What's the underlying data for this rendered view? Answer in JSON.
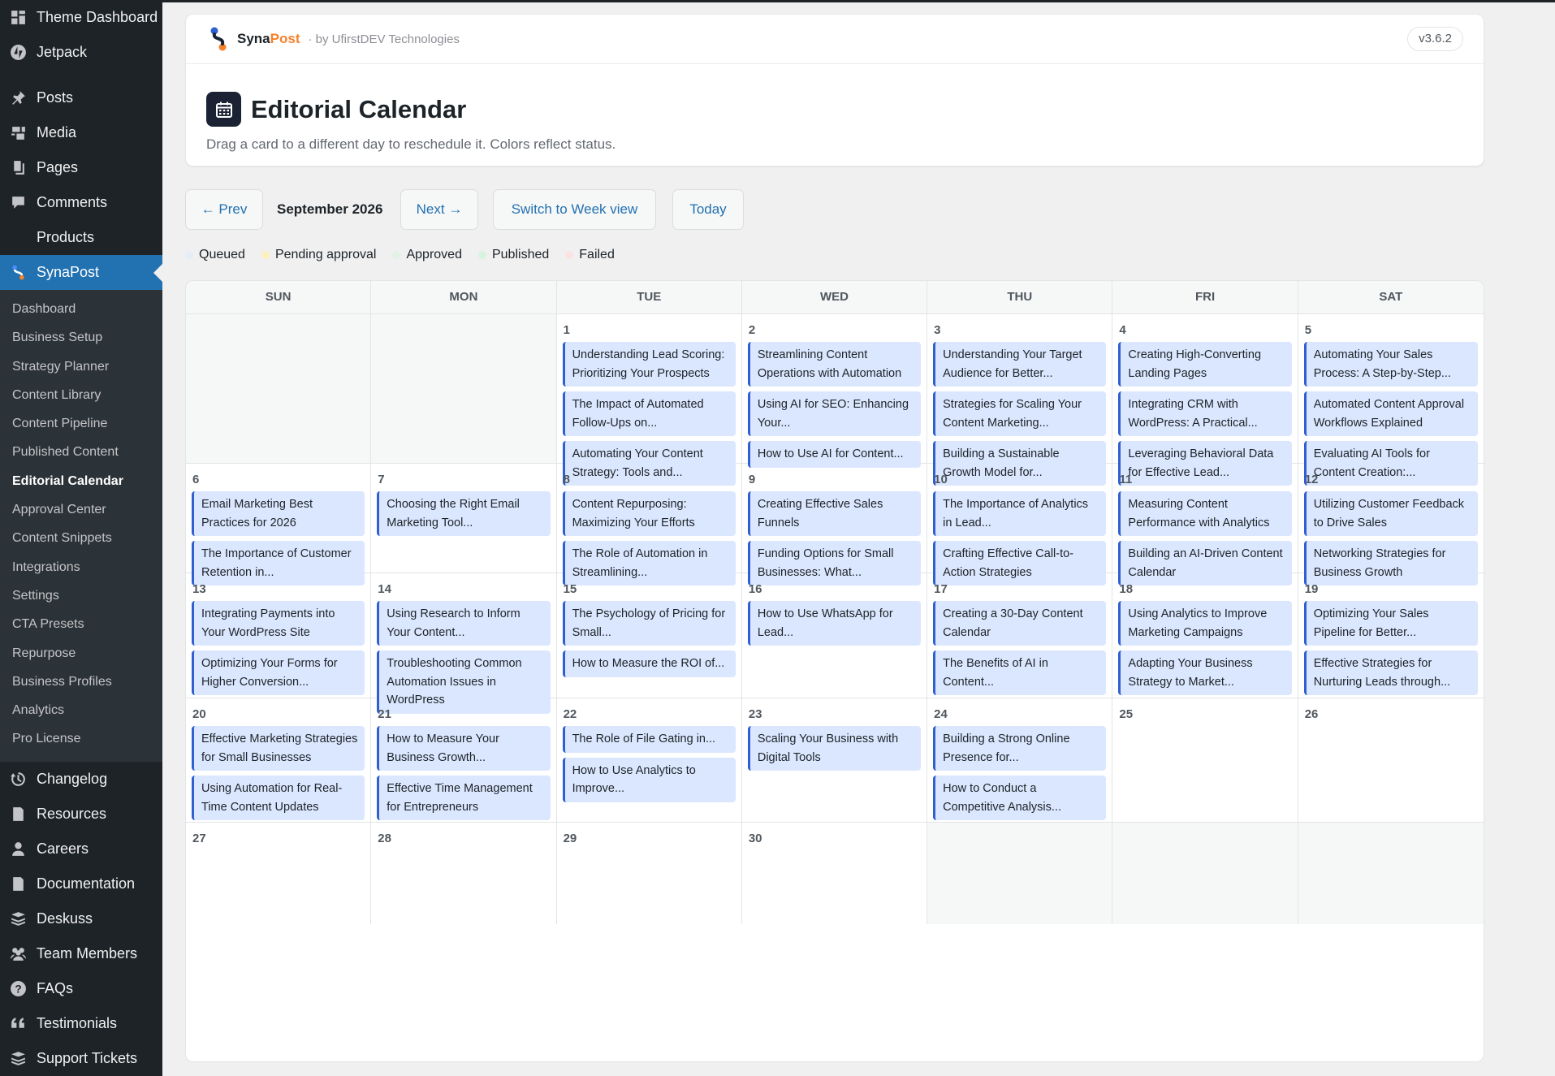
{
  "sidebar": {
    "top_items": [
      {
        "label": "Theme Dashboard",
        "icon": "dashboard-icon"
      },
      {
        "label": "Jetpack",
        "icon": "jetpack-icon"
      }
    ],
    "content_items": [
      {
        "label": "Posts",
        "icon": "pin-icon"
      },
      {
        "label": "Media",
        "icon": "media-icon"
      },
      {
        "label": "Pages",
        "icon": "pages-icon"
      },
      {
        "label": "Comments",
        "icon": "comment-icon"
      },
      {
        "label": "Products",
        "icon": ""
      }
    ],
    "active_item": {
      "label": "SynaPost",
      "icon": "synapost-logo-icon"
    },
    "submenu": [
      "Dashboard",
      "Business Setup",
      "Strategy Planner",
      "Content Library",
      "Content Pipeline",
      "Published Content",
      "Editorial Calendar",
      "Approval Center",
      "Content Snippets",
      "Integrations",
      "Settings",
      "CTA Presets",
      "Repurpose",
      "Business Profiles",
      "Analytics",
      "Pro License"
    ],
    "submenu_current": "Editorial Calendar",
    "bottom_items": [
      {
        "label": "Changelog",
        "icon": "history-icon"
      },
      {
        "label": "Resources",
        "icon": "document-icon"
      },
      {
        "label": "Careers",
        "icon": "user-icon"
      },
      {
        "label": "Documentation",
        "icon": "document-icon"
      },
      {
        "label": "Deskuss",
        "icon": "stack-icon"
      },
      {
        "label": "Team Members",
        "icon": "team-icon"
      },
      {
        "label": "FAQs",
        "icon": "help-icon"
      },
      {
        "label": "Testimonials",
        "icon": "quote-icon"
      },
      {
        "label": "Support Tickets",
        "icon": "stack-icon"
      }
    ]
  },
  "brand": {
    "name_a": "Syna",
    "name_b": "Post",
    "by": "· by UfirstDEV Technologies",
    "version": "v3.6.2"
  },
  "header": {
    "title": "Editorial Calendar",
    "subtitle": "Drag a card to a different day to reschedule it. Colors reflect status."
  },
  "toolbar": {
    "prev": "← Prev",
    "month": "September 2026",
    "next": "Next →",
    "switch": "Switch to Week view",
    "today": "Today"
  },
  "legend": [
    {
      "label": "Queued",
      "color": "#e6edf8"
    },
    {
      "label": "Pending approval",
      "color": "#fdf0bf"
    },
    {
      "label": "Approved",
      "color": "#e3f2e6"
    },
    {
      "label": "Published",
      "color": "#d9f3df"
    },
    {
      "label": "Failed",
      "color": "#fde2e2"
    }
  ],
  "colors": {
    "accent": "#2271b1",
    "card_bg": "#dbe7ff",
    "card_border": "#2f5fd0",
    "sidebar_bg": "#1d2327"
  },
  "calendar": {
    "weekdays": [
      "SUN",
      "MON",
      "TUE",
      "WED",
      "THU",
      "FRI",
      "SAT"
    ],
    "weeks": [
      [
        {
          "day": "",
          "posts": []
        },
        {
          "day": "",
          "posts": []
        },
        {
          "day": "1",
          "posts": [
            "Understanding Lead Scoring: Prioritizing Your Prospects",
            "The Impact of Automated Follow-Ups on...",
            "Automating Your Content Strategy: Tools and..."
          ]
        },
        {
          "day": "2",
          "posts": [
            "Streamlining Content Operations with Automation",
            "Using AI for SEO: Enhancing Your...",
            "How to Use AI for Content..."
          ]
        },
        {
          "day": "3",
          "posts": [
            "Understanding Your Target Audience for Better...",
            "Strategies for Scaling Your Content Marketing...",
            "Building a Sustainable Growth Model for..."
          ]
        },
        {
          "day": "4",
          "posts": [
            "Creating High-Converting Landing Pages",
            "Integrating CRM with WordPress: A Practical...",
            "Leveraging Behavioral Data for Effective Lead..."
          ]
        },
        {
          "day": "5",
          "posts": [
            "Automating Your Sales Process: A Step-by-Step...",
            "Automated Content Approval Workflows Explained",
            "Evaluating AI Tools for Content Creation:..."
          ]
        }
      ],
      [
        {
          "day": "6",
          "posts": [
            "Email Marketing Best Practices for 2026",
            "The Importance of Customer Retention in..."
          ]
        },
        {
          "day": "7",
          "posts": [
            "Choosing the Right Email Marketing Tool..."
          ]
        },
        {
          "day": "8",
          "posts": [
            "Content Repurposing: Maximizing Your Efforts",
            "The Role of Automation in Streamlining..."
          ]
        },
        {
          "day": "9",
          "posts": [
            "Creating Effective Sales Funnels",
            "Funding Options for Small Businesses: What..."
          ]
        },
        {
          "day": "10",
          "posts": [
            "The Importance of Analytics in Lead...",
            "Crafting Effective Call-to-Action Strategies"
          ]
        },
        {
          "day": "11",
          "posts": [
            "Measuring Content Performance with Analytics",
            "Building an AI-Driven Content Calendar"
          ]
        },
        {
          "day": "12",
          "posts": [
            "Utilizing Customer Feedback to Drive Sales",
            "Networking Strategies for Business Growth"
          ]
        }
      ],
      [
        {
          "day": "13",
          "posts": [
            "Integrating Payments into Your WordPress Site",
            "Optimizing Your Forms for Higher Conversion..."
          ]
        },
        {
          "day": "14",
          "posts": [
            "Using Research to Inform Your Content...",
            "Troubleshooting Common Automation Issues in WordPress"
          ]
        },
        {
          "day": "15",
          "posts": [
            "The Psychology of Pricing for Small...",
            "How to Measure the ROI of..."
          ]
        },
        {
          "day": "16",
          "posts": [
            "How to Use WhatsApp for Lead..."
          ]
        },
        {
          "day": "17",
          "posts": [
            "Creating a 30-Day Content Calendar",
            "The Benefits of AI in Content..."
          ]
        },
        {
          "day": "18",
          "posts": [
            "Using Analytics to Improve Marketing Campaigns",
            "Adapting Your Business Strategy to Market..."
          ]
        },
        {
          "day": "19",
          "posts": [
            "Optimizing Your Sales Pipeline for Better...",
            "Effective Strategies for Nurturing Leads through..."
          ]
        }
      ],
      [
        {
          "day": "20",
          "posts": [
            "Effective Marketing Strategies for Small Businesses",
            "Using Automation for Real-Time Content Updates"
          ]
        },
        {
          "day": "21",
          "posts": [
            "How to Measure Your Business Growth...",
            "Effective Time Management for Entrepreneurs"
          ]
        },
        {
          "day": "22",
          "posts": [
            "The Role of File Gating in...",
            "How to Use Analytics to Improve..."
          ]
        },
        {
          "day": "23",
          "posts": [
            "Scaling Your Business with Digital Tools"
          ]
        },
        {
          "day": "24",
          "posts": [
            "Building a Strong Online Presence for...",
            "How to Conduct a Competitive Analysis..."
          ]
        },
        {
          "day": "25",
          "posts": []
        },
        {
          "day": "26",
          "posts": []
        }
      ],
      [
        {
          "day": "27",
          "posts": []
        },
        {
          "day": "28",
          "posts": []
        },
        {
          "day": "29",
          "posts": []
        },
        {
          "day": "30",
          "posts": []
        },
        {
          "day": "",
          "posts": []
        },
        {
          "day": "",
          "posts": []
        },
        {
          "day": "",
          "posts": []
        }
      ]
    ]
  }
}
